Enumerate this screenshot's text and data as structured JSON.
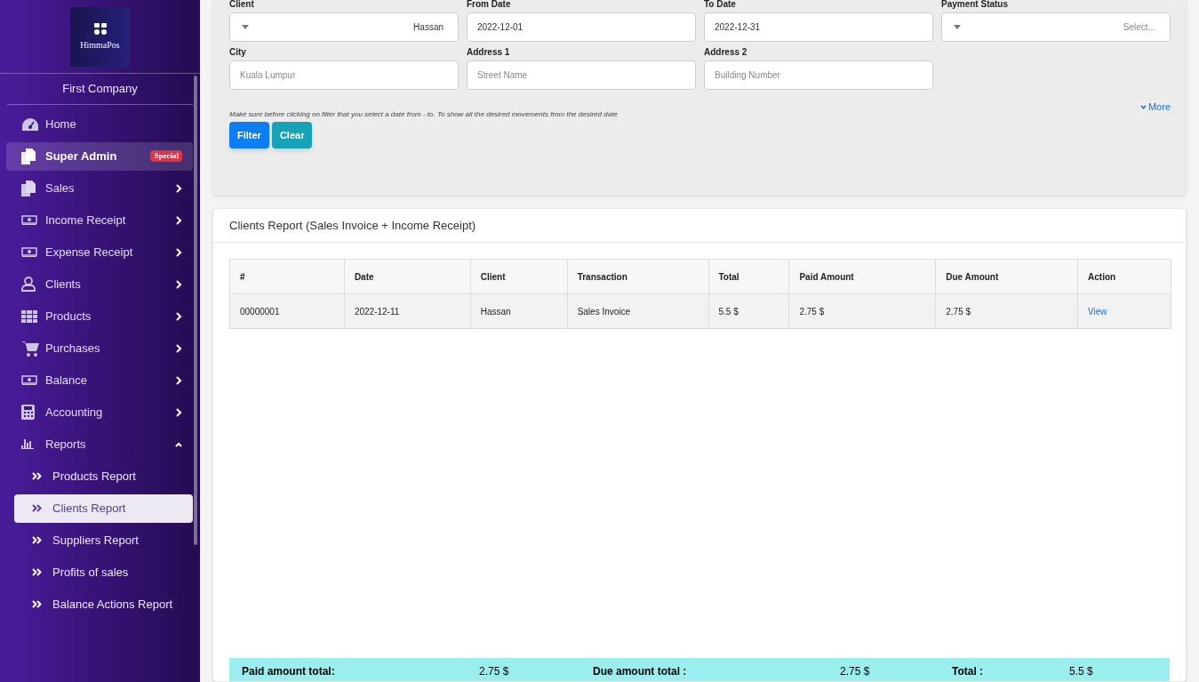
{
  "sidebar": {
    "logo": "HimmaPos",
    "company": "First Company",
    "items": [
      {
        "label": "Home",
        "selected": false
      },
      {
        "label": "Super Admin",
        "selected": true,
        "badge": "Special"
      },
      {
        "label": "Sales",
        "selected": false,
        "expanded": false
      },
      {
        "label": "Income Receipt",
        "selected": false,
        "expanded": false
      },
      {
        "label": "Expense Receipt",
        "selected": false,
        "expanded": false
      },
      {
        "label": "Clients",
        "selected": false,
        "expanded": false
      },
      {
        "label": "Products",
        "selected": false,
        "expanded": false
      },
      {
        "label": "Purchases",
        "selected": false,
        "expanded": false
      },
      {
        "label": "Balance",
        "selected": false,
        "expanded": false
      },
      {
        "label": "Accounting",
        "selected": false,
        "expanded": false
      },
      {
        "label": "Reports",
        "selected": false,
        "expanded": true,
        "children": [
          {
            "label": "Products Report",
            "selected": false
          },
          {
            "label": "Clients Report",
            "selected": true
          },
          {
            "label": "Suppliers Report",
            "selected": false
          },
          {
            "label": "Profits of sales",
            "selected": false
          },
          {
            "label": "Balance Actions Report",
            "selected": false
          }
        ]
      }
    ]
  },
  "filters": {
    "fields": [
      {
        "kind": "select",
        "label": "Client",
        "value": "Hassan"
      },
      {
        "kind": "input",
        "label": "From Date",
        "value": "2022-12-01"
      },
      {
        "kind": "input",
        "label": "To Date",
        "value": "2022-12-31"
      },
      {
        "kind": "select",
        "label": "Payment Status",
        "placeholder": "Select..."
      },
      {
        "kind": "input",
        "label": "City",
        "placeholder": "Kuala Lumpur"
      },
      {
        "kind": "input",
        "label": "Address 1",
        "placeholder": "Street Name"
      },
      {
        "kind": "input",
        "label": "Address 2",
        "placeholder": "Building Number"
      }
    ],
    "more_link": "More",
    "hint": "Make sure before clicking on filter that you select a date from - to. To show all the desired movements from the desired date",
    "buttons": [
      {
        "kind": "primary",
        "label": "Filter"
      },
      {
        "kind": "info",
        "label": "Clear"
      }
    ]
  },
  "report": {
    "title": "Clients Report (Sales Invoice + Income Receipt)",
    "table": {
      "columns": [
        "#",
        "Date",
        "Client",
        "Transaction",
        "Total",
        "Paid Amount",
        "Due Amount",
        "Action"
      ],
      "rows": [
        {
          "cells": [
            "00000001",
            "2022-12-11",
            "Hassan",
            "Sales Invoice",
            "5.5 $",
            "2.75 $",
            "2.75 $"
          ],
          "action": "View"
        }
      ]
    },
    "totals": [
      {
        "label": "Paid amount total:",
        "value": "2.75 $"
      },
      {
        "label": "Due amount total :",
        "value": "2.75 $"
      },
      {
        "label": "Total :",
        "value": "5.5 $"
      }
    ]
  }
}
